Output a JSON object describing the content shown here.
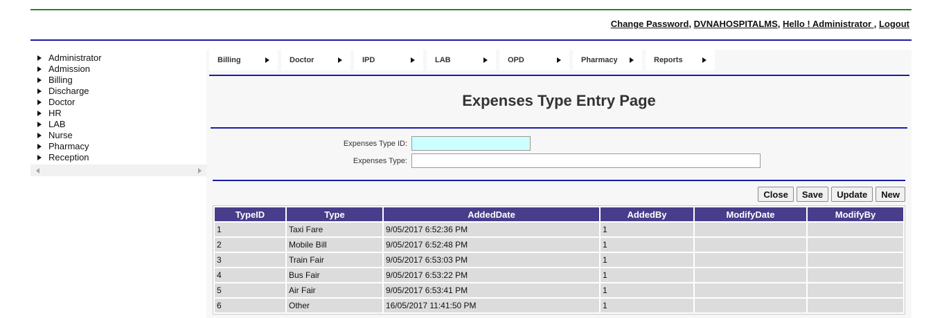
{
  "header": {
    "change_password": "Change Password",
    "sep1": ", ",
    "hospital": "DVNAHOSPITALMS",
    "sep2": ", ",
    "greeting": "Hello ! Administrator ",
    "sep3": ", ",
    "logout": "Logout"
  },
  "sidebar": {
    "items": [
      {
        "label": "Administrator"
      },
      {
        "label": "Admission"
      },
      {
        "label": "Billing"
      },
      {
        "label": "Discharge"
      },
      {
        "label": "Doctor"
      },
      {
        "label": "HR"
      },
      {
        "label": "LAB"
      },
      {
        "label": "Nurse"
      },
      {
        "label": "Pharmacy"
      },
      {
        "label": "Reception"
      }
    ]
  },
  "menu": {
    "items": [
      {
        "label": "Billing"
      },
      {
        "label": "Doctor"
      },
      {
        "label": "IPD"
      },
      {
        "label": "LAB"
      },
      {
        "label": "OPD"
      },
      {
        "label": "Pharmacy"
      },
      {
        "label": "Reports"
      }
    ]
  },
  "page": {
    "title": "Expenses Type Entry Page"
  },
  "form": {
    "type_id_label": "Expenses Type ID:",
    "type_id_value": "",
    "type_label": "Expenses Type:",
    "type_value": ""
  },
  "buttons": {
    "close": "Close",
    "save": "Save",
    "update": "Update",
    "new": "New"
  },
  "table": {
    "columns": [
      "TypeID",
      "Type",
      "AddedDate",
      "AddedBy",
      "ModifyDate",
      "ModifyBy"
    ],
    "rows": [
      [
        "1",
        "Taxi Fare",
        "9/05/2017 6:52:36 PM",
        "1",
        "",
        ""
      ],
      [
        "2",
        "Mobile Bill",
        "9/05/2017 6:52:48 PM",
        "1",
        "",
        ""
      ],
      [
        "3",
        "Train Fair",
        "9/05/2017 6:53:03 PM",
        "1",
        "",
        ""
      ],
      [
        "4",
        "Bus Fair",
        "9/05/2017 6:53:22 PM",
        "1",
        "",
        ""
      ],
      [
        "5",
        "Air Fair",
        "9/05/2017 6:53:41 PM",
        "1",
        "",
        ""
      ],
      [
        "6",
        "Other",
        "16/05/2017 11:41:50 PM",
        "1",
        "",
        ""
      ]
    ]
  },
  "colors": {
    "header_rule": "#1a1aa8",
    "top_rule": "#2e7d32",
    "grid_header": "#483d8b",
    "grid_cell": "#dcdcdc",
    "id_input_bg": "#ccffff"
  }
}
